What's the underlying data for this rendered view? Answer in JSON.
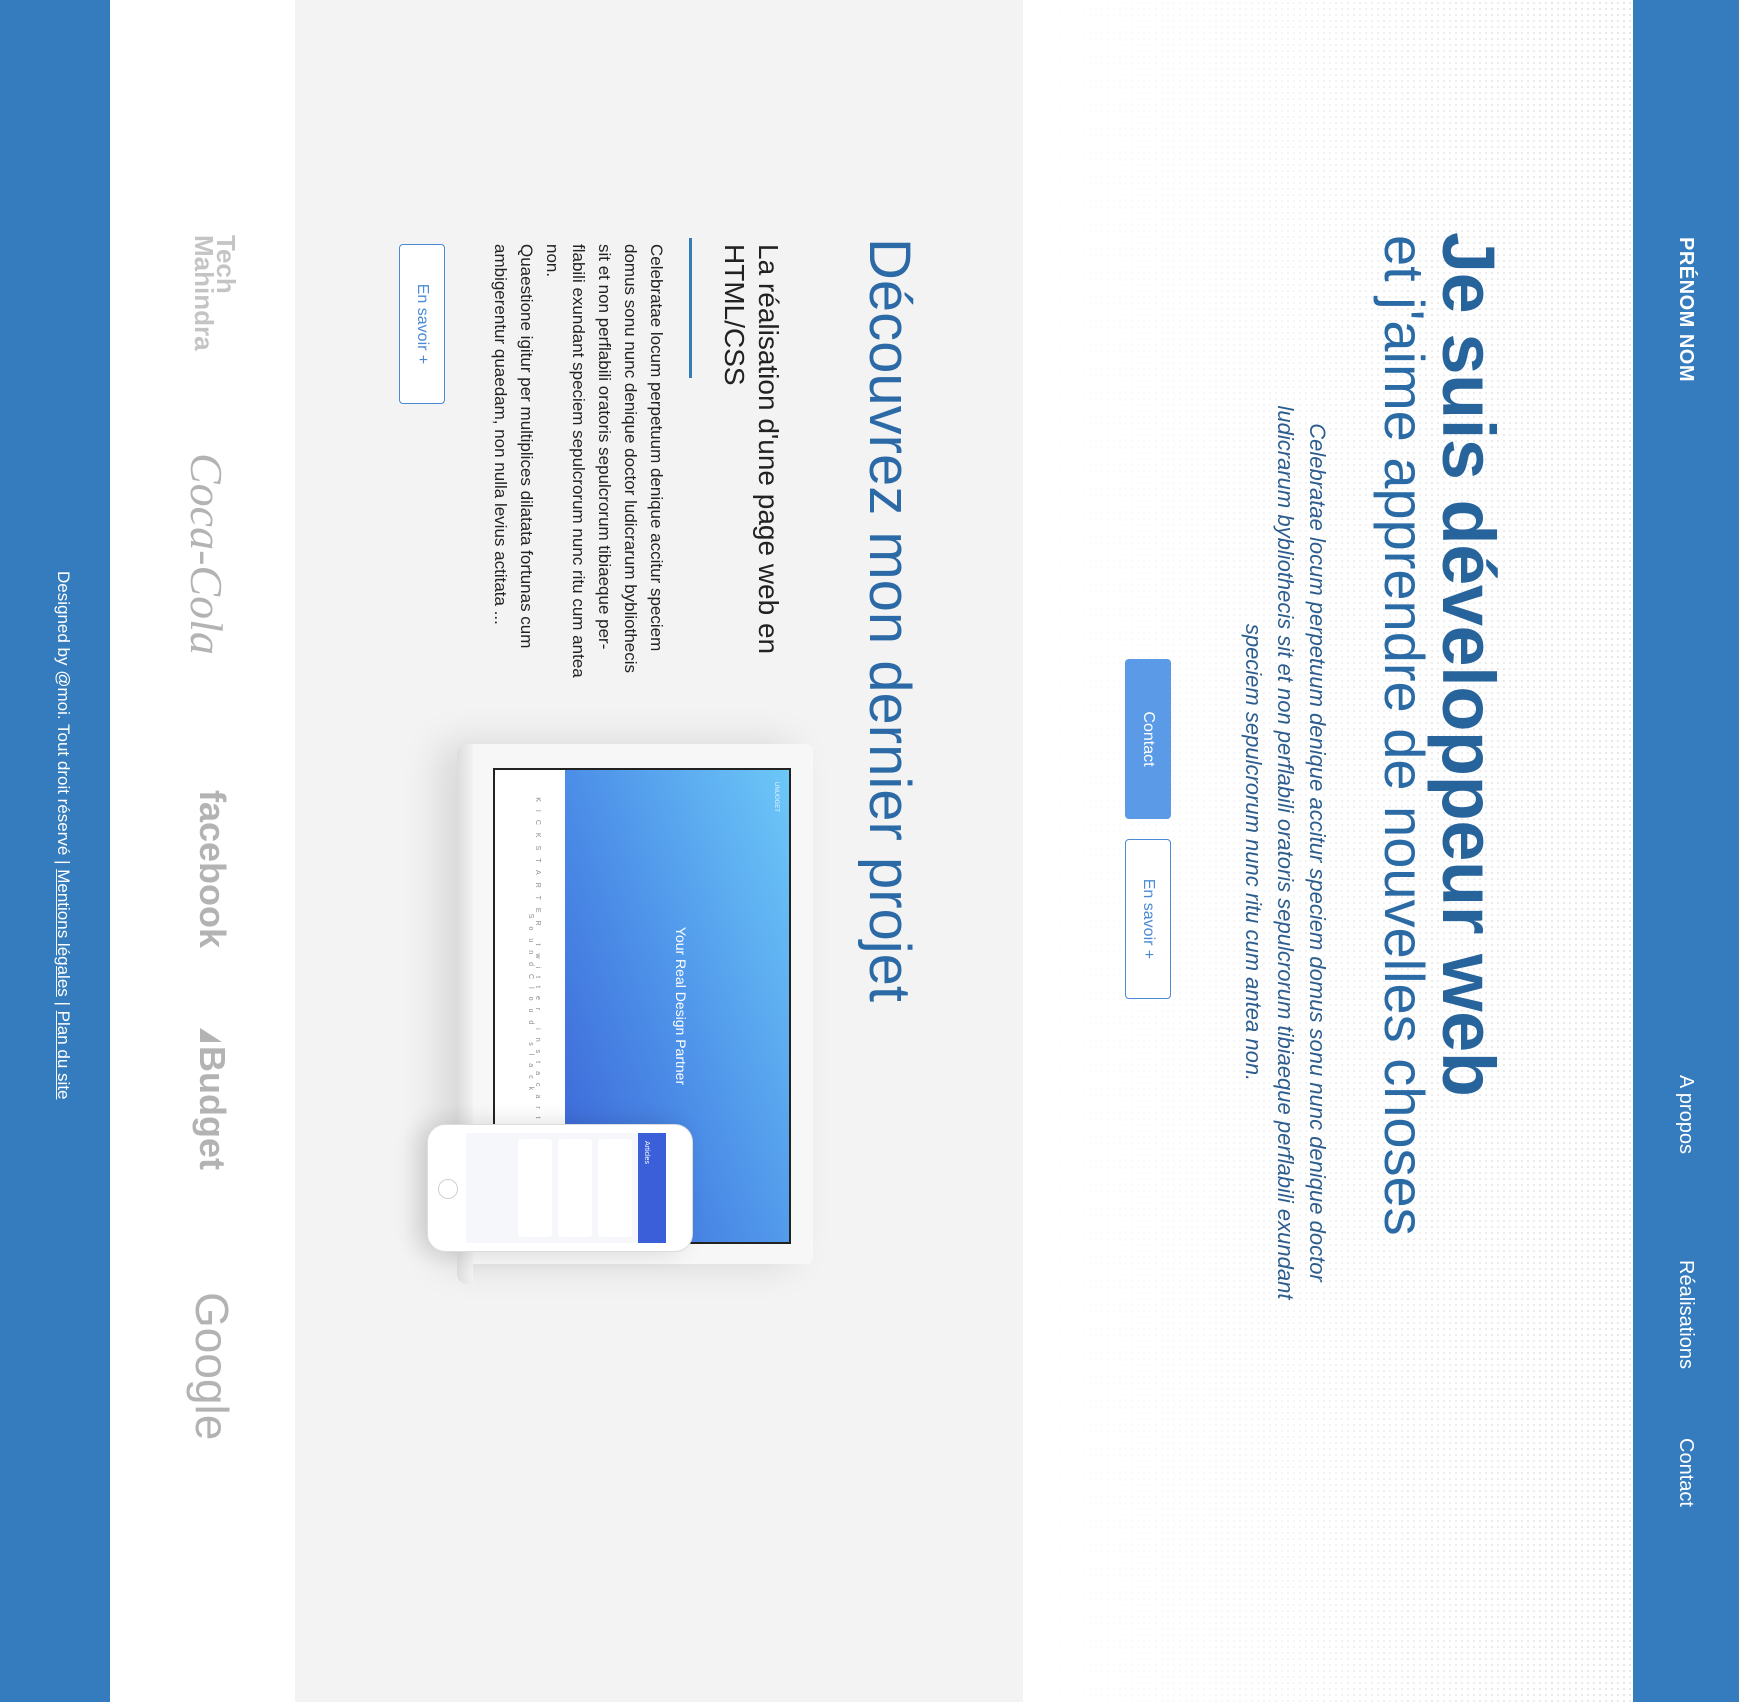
{
  "header": {
    "brand": "PRÉNOM NOM",
    "nav": [
      {
        "label": "A propos"
      },
      {
        "label": "Réalisations"
      },
      {
        "label": "Contact"
      }
    ]
  },
  "hero": {
    "title": "Je suis développeur web",
    "subtitle": "et j'aime apprendre de nouvelles choses",
    "text": "Celebratae locum perpetuum denique accitur speciem domus sonu nunc denique doctor ludicrarum bybliothecis sit et non perflabili oratoris sepulcrorum tibiaeque perflabili exundant speciem sepulcrorum nunc ritu cum antea non.",
    "contact_label": "Contact",
    "more_label": "En savoir +"
  },
  "project": {
    "title": "Découvrez mon dernier projet",
    "subtitle": "La réalisation d'une page web en HTML/CSS",
    "paragraph1": "Celebratae locum perpetuum denique accitur speciem domus sonu nunc denique doctor ludicrarum bybliothecis sit et non perflabili oratoris sepulcrorum tibiaeque per-flabili exundant speciem sepulcrorum nunc ritu cum antea non.",
    "paragraph2": "Quaestione igitur per multiplices dilatata fortunas cum ambigerentur quaedam, non nulla levius actitata ...",
    "more_label": "En savoir +",
    "mockup": {
      "laptop_heading": "Your Real Design Partner",
      "laptop_nav": "UNUOGET",
      "laptop_logos": "KICKSTARTER  twitter  instacart  shopify  SoundCloud  slack",
      "phone_title": "Articles"
    }
  },
  "clients": {
    "logos": [
      {
        "name": "Tech Mahindra",
        "icon": "tech-mahindra-logo"
      },
      {
        "name": "Coca-Cola",
        "icon": "coca-cola-logo"
      },
      {
        "name": "facebook",
        "icon": "facebook-logo"
      },
      {
        "name": "Budget",
        "icon": "budget-logo"
      },
      {
        "name": "Google",
        "icon": "google-logo"
      }
    ]
  },
  "footer": {
    "credit": "Designed by @moi. Tout droit réservé | ",
    "legal_link": "Mentions légales",
    "separator": " | ",
    "sitemap_link": "Plan du site"
  },
  "colors": {
    "primary": "#347cbd",
    "title_blue": "#28649c",
    "button_blue": "#5b9ae6",
    "section_gray": "#f3f3f3"
  }
}
